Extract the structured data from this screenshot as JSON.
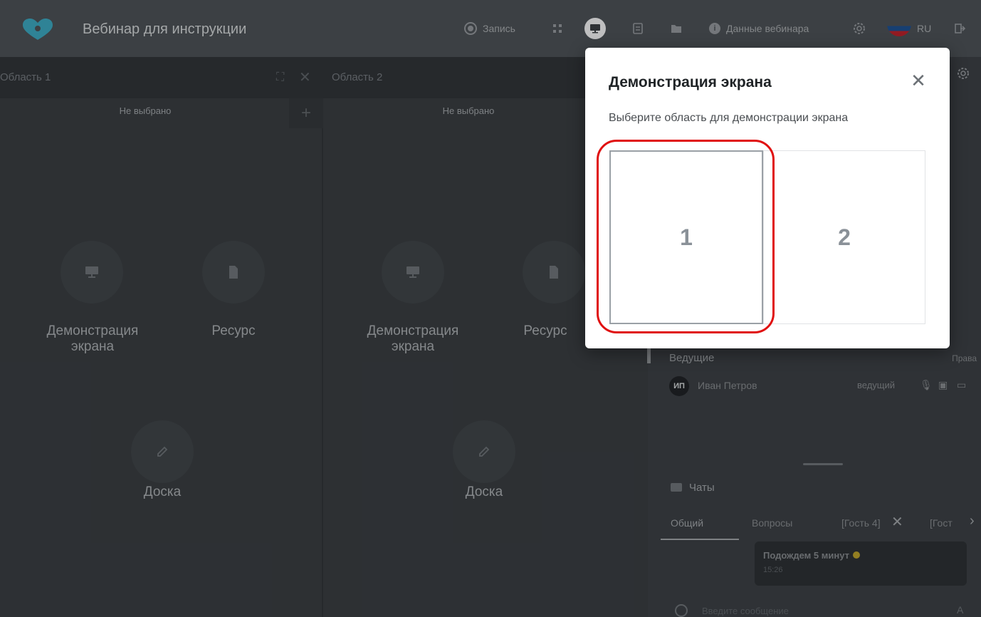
{
  "app": {
    "title": "Вебинар для инструкции"
  },
  "toolbar": {
    "record_label": "Запись",
    "webinar_data_label": "Данные вебинара",
    "lang_label": "RU"
  },
  "areas": [
    {
      "title": "Область 1",
      "status": "Не выбрано",
      "screen_label": "Демонстрация экрана",
      "resource_label": "Ресурс",
      "board_label": "Доска"
    },
    {
      "title": "Область 2",
      "status": "Не выбрано",
      "screen_label": "Демонстрация экрана",
      "resource_label": "Ресурс",
      "board_label": "Доска"
    }
  ],
  "participants": {
    "group_label": "Ведущие",
    "rights_label": "Права",
    "items": [
      {
        "initials": "ИП",
        "name": "Иван Петров",
        "role": "ведущий"
      }
    ]
  },
  "chats": {
    "title": "Чаты",
    "tabs": [
      "Общий",
      "Вопросы",
      "[Гость 4]",
      "[Гост"
    ],
    "message": {
      "text": "Подождем 5 минут",
      "time": "15:26"
    },
    "input_placeholder": "Введите сообщение"
  },
  "modal": {
    "title": "Демонстрация экрана",
    "subtitle": "Выберите область для демонстрации экрана",
    "options": [
      "1",
      "2"
    ]
  },
  "colors": {
    "highlight": "#e01010",
    "topbar": "#4a4f54",
    "brand": "#3aa0b8"
  }
}
